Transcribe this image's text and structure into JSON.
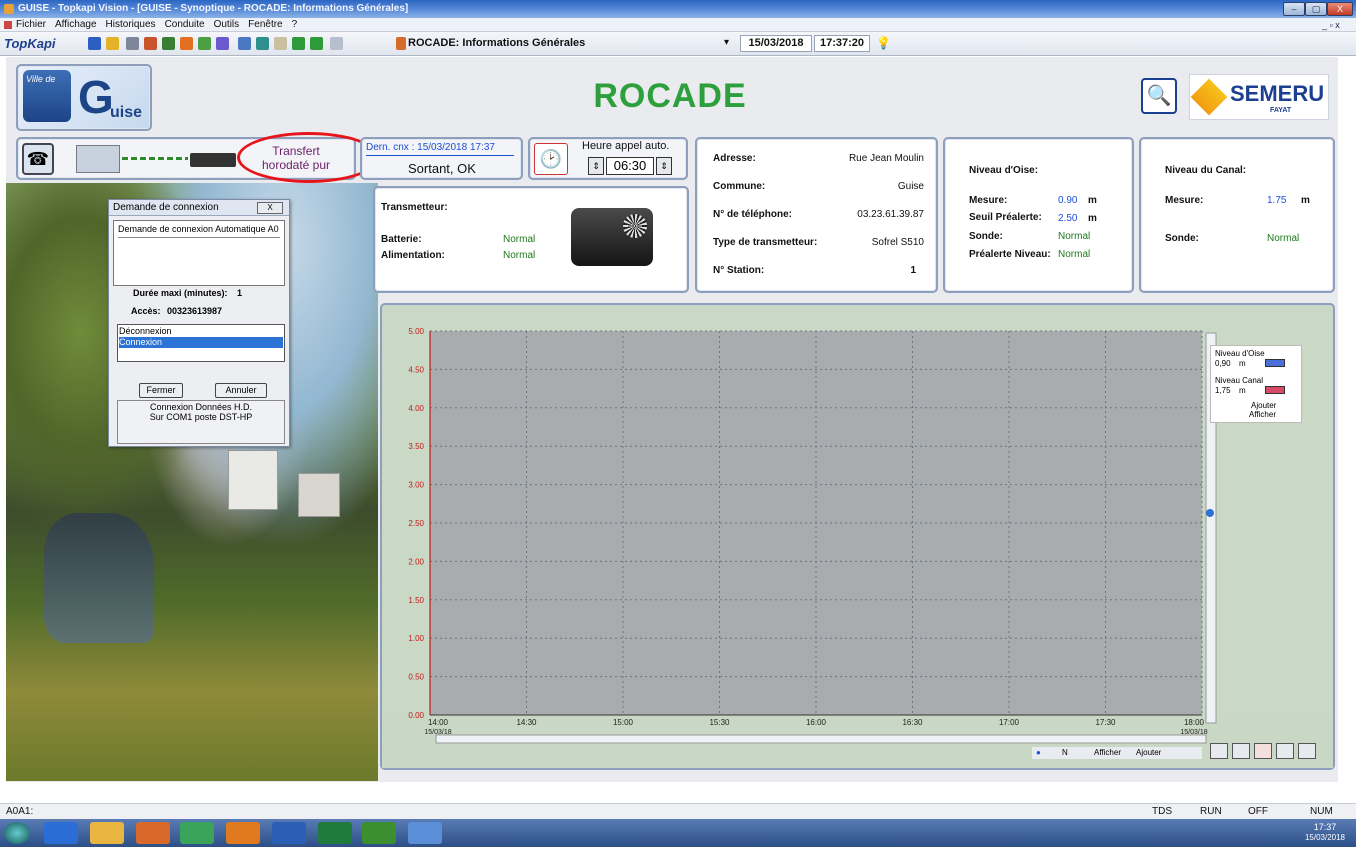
{
  "window": {
    "title": "GUISE - Topkapi Vision - [GUISE - Synoptique - ROCADE: Informations Générales]",
    "btn_min": "–",
    "btn_max": "▢",
    "btn_close": "X",
    "inner_btns": "_ ▫ x"
  },
  "menu": [
    "Fichier",
    "Affichage",
    "Historiques",
    "Conduite",
    "Outils",
    "Fenêtre",
    "?"
  ],
  "toolbar": {
    "logo": "TopKapi",
    "view_title": "ROCADE: Informations Générales",
    "date": "15/03/2018",
    "time": "17:37:20"
  },
  "header": {
    "site_logo": "Ville de",
    "site_logo_big": "uise",
    "site_logo_g": "G",
    "title": "ROCADE",
    "brand": "SEMERU",
    "brand_sub": "FAYAT"
  },
  "comm": {
    "transfert_line1": "Transfert",
    "transfert_line2": "horodaté pur",
    "last_cnx": "Dern. cnx : 15/03/2018 17:37",
    "state": "Sortant, OK",
    "auto_label": "Heure appel auto.",
    "auto_time": "06:30"
  },
  "transmetteur": {
    "title": "Transmetteur:",
    "batt_label": "Batterie:",
    "batt_val": "Normal",
    "alim_label": "Alimentation:",
    "alim_val": "Normal"
  },
  "address": {
    "rows": [
      {
        "k": "Adresse:",
        "v": "Rue Jean Moulin"
      },
      {
        "k": "Commune:",
        "v": "Guise"
      },
      {
        "k": "N° de téléphone:",
        "v": "03.23.61.39.87"
      },
      {
        "k": "Type de transmetteur:",
        "v": "Sofrel S510"
      },
      {
        "k": "N° Station:",
        "v": "1"
      }
    ]
  },
  "oise": {
    "title": "Niveau d'Oise:",
    "mesure_label": "Mesure:",
    "mesure_val": "0.90",
    "unit": "m",
    "seuil_label": "Seuil Préalerte:",
    "seuil_val": "2.50",
    "sonde_label": "Sonde:",
    "sonde_val": "Normal",
    "pre_label": "Préalerte Niveau:",
    "pre_val": "Normal"
  },
  "canal": {
    "title": "Niveau du Canal:",
    "mesure_label": "Mesure:",
    "mesure_val": "1.75",
    "unit": "m",
    "sonde_label": "Sonde:",
    "sonde_val": "Normal"
  },
  "dialog": {
    "title": "Demande de connexion",
    "close": "X",
    "subtitle": "Demande de connexion Automatique A0",
    "duree_label": "Durée maxi (minutes):",
    "duree_val": "1",
    "acces_label": "Accès:",
    "acces_val": "00323613987",
    "list": [
      "Déconnexion",
      "Connexion"
    ],
    "btn_close": "Fermer",
    "btn_cancel": "Annuler",
    "footer1": "Connexion Données H.D.",
    "footer2": "Sur COM1 poste DST-HP"
  },
  "chart_data": {
    "type": "line",
    "y_ticks": [
      "5.00",
      "4.50",
      "4.00",
      "3.50",
      "3.00",
      "2.50",
      "2.00",
      "1.50",
      "1.00",
      "0.50",
      "0.00"
    ],
    "ylim": [
      0,
      5
    ],
    "x_ticks": [
      {
        "t": "14:00",
        "d": "15/03/18"
      },
      {
        "t": "14:30",
        "d": ""
      },
      {
        "t": "15:00",
        "d": ""
      },
      {
        "t": "15:30",
        "d": ""
      },
      {
        "t": "16:00",
        "d": ""
      },
      {
        "t": "16:30",
        "d": ""
      },
      {
        "t": "17:00",
        "d": ""
      },
      {
        "t": "17:30",
        "d": ""
      },
      {
        "t": "18:00",
        "d": "15/03/18"
      }
    ],
    "series": [
      {
        "name": "Niveau d'Oise",
        "value_label": "0,90",
        "unit": "m"
      },
      {
        "name": "Niveau Canal",
        "value_label": "1,75",
        "unit": "m"
      }
    ],
    "legend_actions": [
      "Ajouter",
      "Afficher"
    ],
    "nav": "N",
    "nav_actions": [
      "Afficher",
      "Ajouter"
    ],
    "grid": true,
    "legend_placement": "right"
  },
  "status": {
    "left": "A0A1:",
    "tds": "TDS",
    "run": "RUN",
    "off": "OFF",
    "num": "NUM"
  },
  "taskbar": {
    "clock_time": "17:37",
    "clock_date": "15/03/2018"
  }
}
